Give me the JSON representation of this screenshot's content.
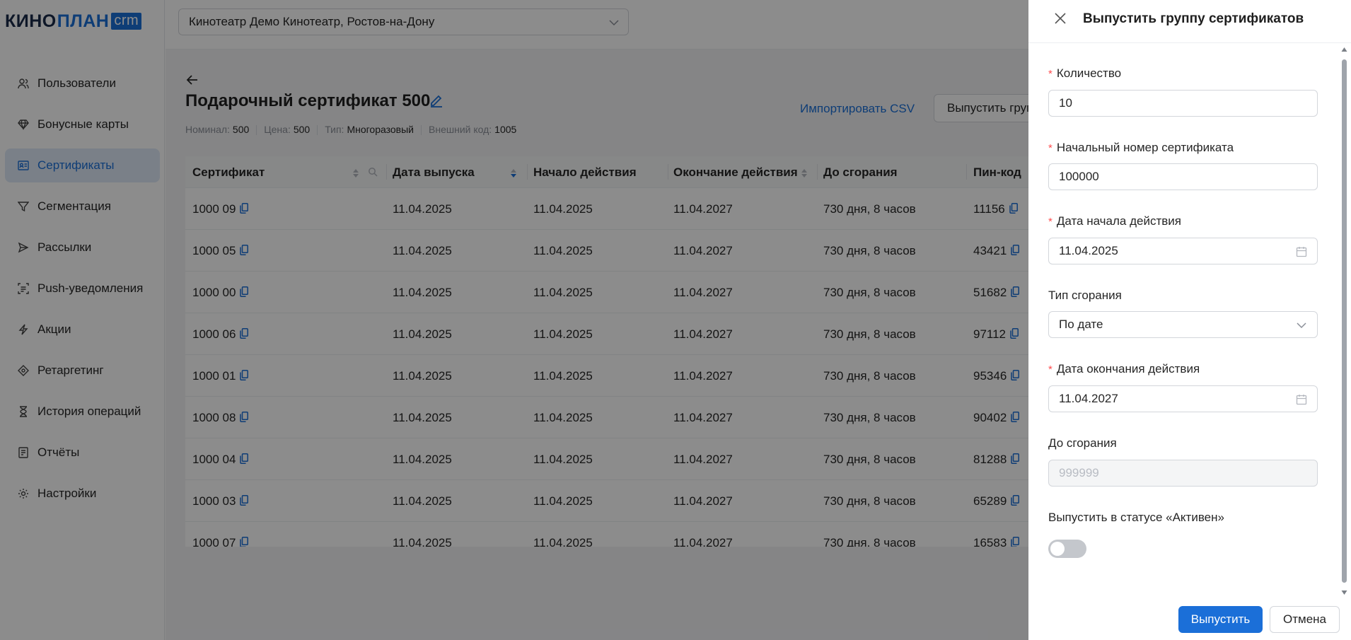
{
  "logo": {
    "part1": "КИНО",
    "part2": "ПЛАН",
    "badge": "crm"
  },
  "cinema": {
    "value": "Кинотеатр Демо Кинотеатр, Ростов-на-Дону"
  },
  "sidebar": {
    "items": [
      {
        "label": "Пользователи",
        "icon": "users-icon"
      },
      {
        "label": "Бонусные карты",
        "icon": "diamond-icon"
      },
      {
        "label": "Сертификаты",
        "icon": "certificate-icon",
        "active": true
      },
      {
        "label": "Сегментация",
        "icon": "filter-icon"
      },
      {
        "label": "Рассылки",
        "icon": "send-icon"
      },
      {
        "label": "Push-уведомления",
        "icon": "push-icon"
      },
      {
        "label": "Акции",
        "icon": "lightning-icon"
      },
      {
        "label": "Ретаргетинг",
        "icon": "target-icon"
      },
      {
        "label": "История операций",
        "icon": "hourglass-icon"
      },
      {
        "label": "Отчёты",
        "icon": "report-icon"
      },
      {
        "label": "Настройки",
        "icon": "gear-icon"
      }
    ]
  },
  "page": {
    "title": "Подарочный сертификат 500",
    "meta": {
      "nominal_label": "Номинал:",
      "nominal_value": "500",
      "price_label": "Цена:",
      "price_value": "500",
      "type_label": "Тип:",
      "type_value": "Многоразовый",
      "code_label": "Внешний код:",
      "code_value": "1005"
    },
    "import_label": "Импортировать CSV",
    "issue_label": "Выпустить группу сертификатов"
  },
  "table": {
    "columns": [
      "Сертификат",
      "Дата выпуска",
      "Начало действия",
      "Окончание действия",
      "До сгорания",
      "Пин-код"
    ],
    "rows": [
      [
        "1000 09",
        "11.04.2025",
        "11.04.2025",
        "11.04.2027",
        "730 дня, 8 часов",
        "11156"
      ],
      [
        "1000 05",
        "11.04.2025",
        "11.04.2025",
        "11.04.2027",
        "730 дня, 8 часов",
        "43421"
      ],
      [
        "1000 00",
        "11.04.2025",
        "11.04.2025",
        "11.04.2027",
        "730 дня, 8 часов",
        "51682"
      ],
      [
        "1000 06",
        "11.04.2025",
        "11.04.2025",
        "11.04.2027",
        "730 дня, 8 часов",
        "97112"
      ],
      [
        "1000 01",
        "11.04.2025",
        "11.04.2025",
        "11.04.2027",
        "730 дня, 8 часов",
        "95346"
      ],
      [
        "1000 08",
        "11.04.2025",
        "11.04.2025",
        "11.04.2027",
        "730 дня, 8 часов",
        "90402"
      ],
      [
        "1000 04",
        "11.04.2025",
        "11.04.2025",
        "11.04.2027",
        "730 дня, 8 часов",
        "81288"
      ],
      [
        "1000 03",
        "11.04.2025",
        "11.04.2025",
        "11.04.2027",
        "730 дня, 8 часов",
        "65289"
      ],
      [
        "1000 07",
        "11.04.2025",
        "11.04.2025",
        "11.04.2027",
        "730 дня, 8 часов",
        "16583"
      ]
    ]
  },
  "drawer": {
    "title": "Выпустить группу сертификатов",
    "quantity": {
      "label": "Количество",
      "value": "10"
    },
    "start_number": {
      "label": "Начальный номер сертификата",
      "value": "100000"
    },
    "start_date": {
      "label": "Дата начала действия",
      "value": "11.04.2025"
    },
    "expire_type": {
      "label": "Тип сгорания",
      "value": "По дате"
    },
    "end_date": {
      "label": "Дата окончания действия",
      "value": "11.04.2027"
    },
    "until_burn": {
      "label": "До сгорания",
      "placeholder": "999999"
    },
    "active_toggle": {
      "label": "Выпустить в статусе «Активен»",
      "on": false
    },
    "submit_label": "Выпустить",
    "cancel_label": "Отмена"
  },
  "colors": {
    "accent": "#1b6fd8",
    "required": "#ff4d4f"
  }
}
